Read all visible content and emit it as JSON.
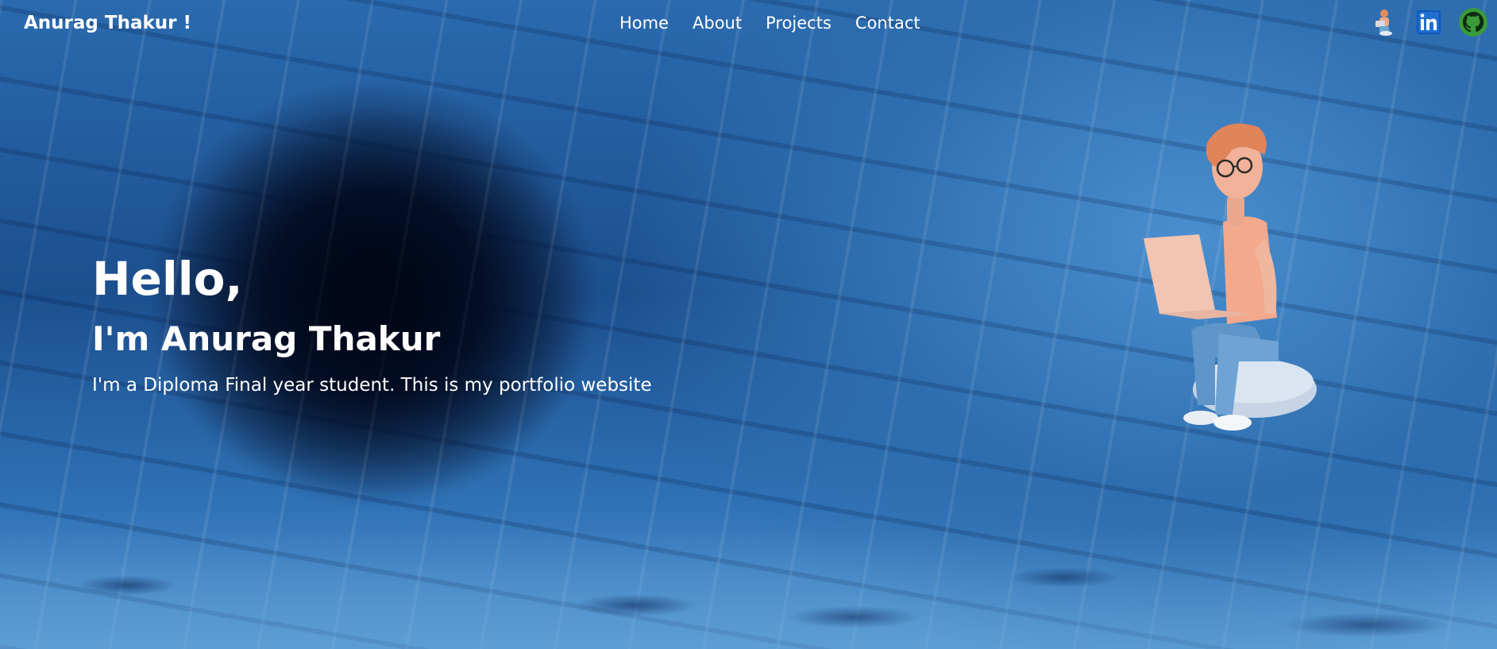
{
  "nav": {
    "brand": "Anurag Thakur !",
    "links": [
      "Home",
      "About",
      "Projects",
      "Contact"
    ],
    "social": [
      {
        "icon": "avatar-icon"
      },
      {
        "icon": "linkedin-icon",
        "text": "in"
      },
      {
        "icon": "github-icon"
      }
    ]
  },
  "hero": {
    "greeting": "Hello,",
    "name": "I'm Anurag Thakur",
    "description": "I'm a Diploma Final year student. This is my portfolio website"
  },
  "colors": {
    "background": "#2a6aae",
    "linkedin": "#1f6fd1",
    "github": "#3a9b3a"
  }
}
